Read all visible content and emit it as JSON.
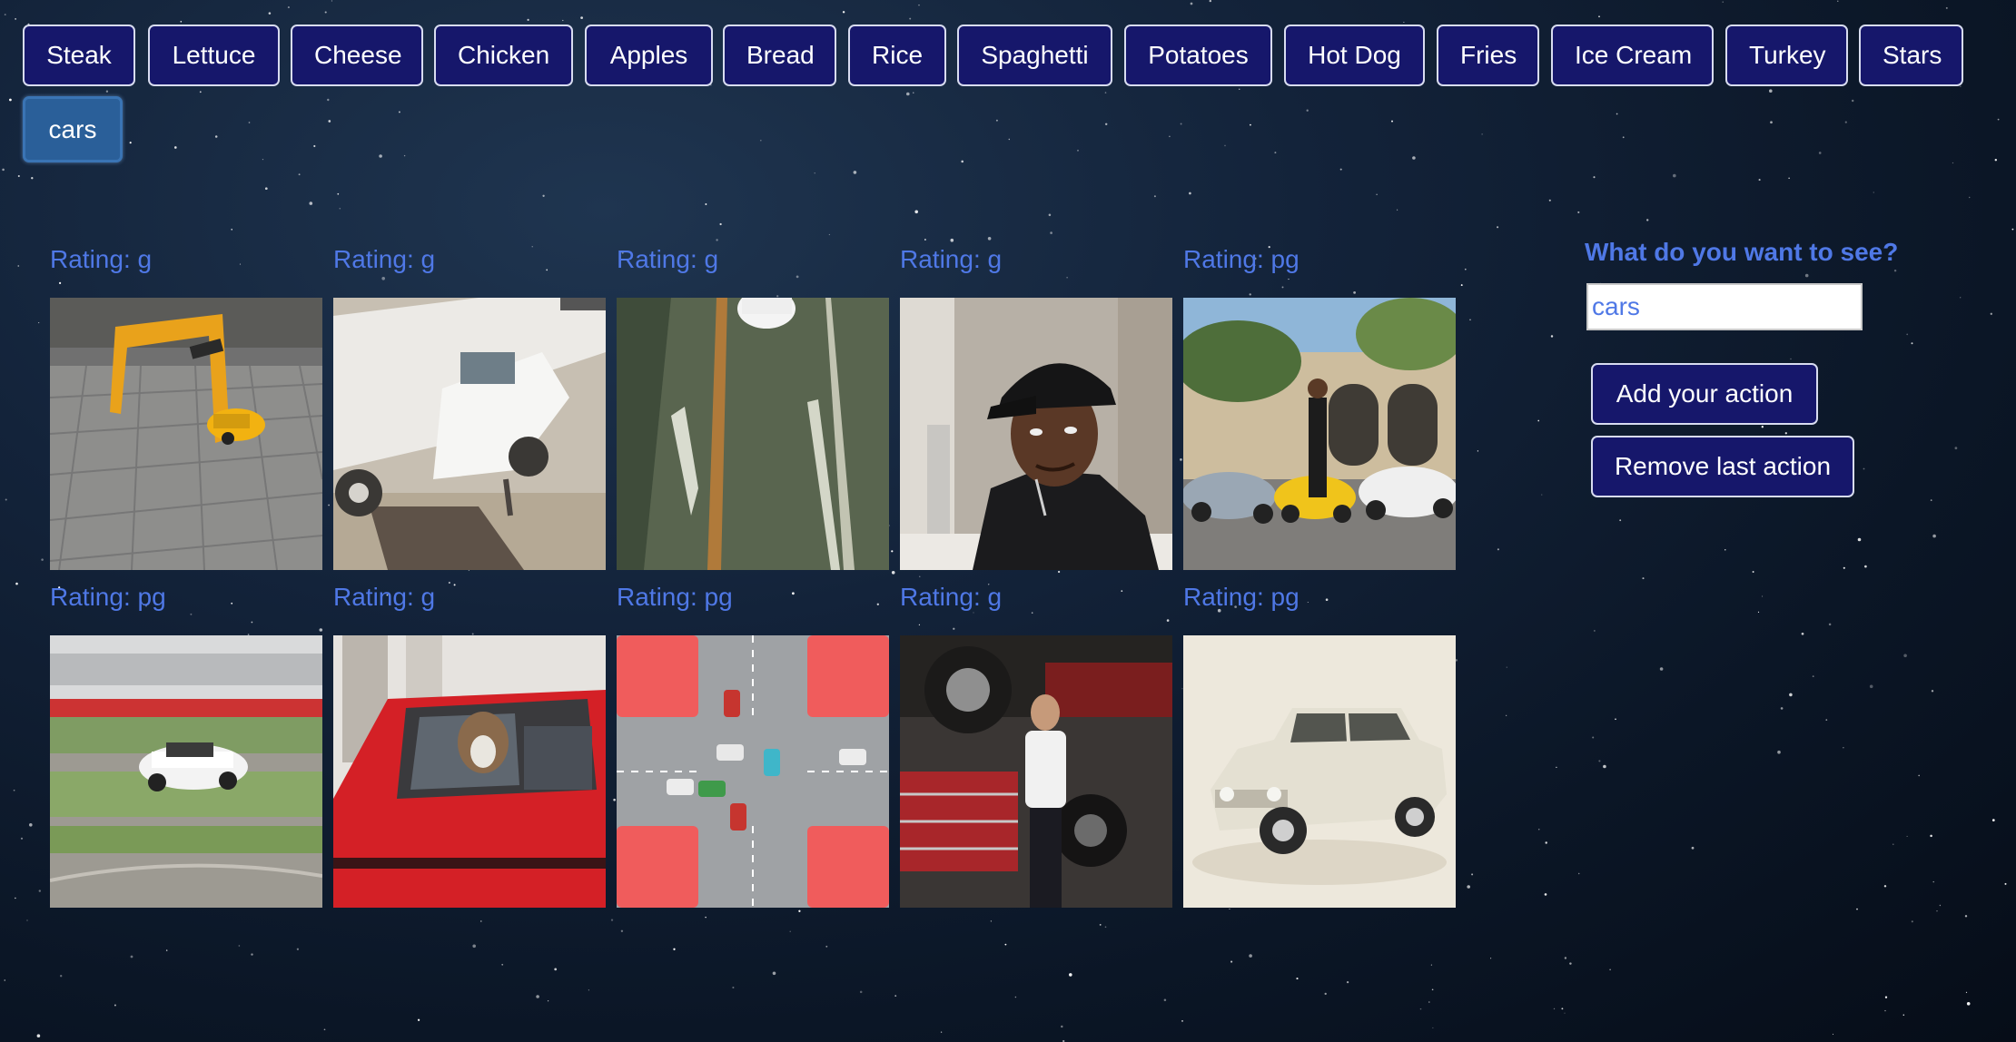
{
  "topics": [
    {
      "label": "Steak"
    },
    {
      "label": "Lettuce"
    },
    {
      "label": "Cheese"
    },
    {
      "label": "Chicken"
    },
    {
      "label": "Apples"
    },
    {
      "label": "Bread"
    },
    {
      "label": "Rice"
    },
    {
      "label": "Spaghetti"
    },
    {
      "label": "Potatoes"
    },
    {
      "label": "Hot Dog"
    },
    {
      "label": "Fries"
    },
    {
      "label": "Ice Cream"
    },
    {
      "label": "Turkey"
    },
    {
      "label": "Stars"
    },
    {
      "label": "cars",
      "active": true
    }
  ],
  "gifs": [
    {
      "rating": "Rating: g",
      "subject": "yellow-sports-car-gif"
    },
    {
      "rating": "Rating: g",
      "subject": "tow-truck-gif"
    },
    {
      "rating": "Rating: g",
      "subject": "highway-road-gif"
    },
    {
      "rating": "Rating: g",
      "subject": "man-in-cap-gif"
    },
    {
      "rating": "Rating: pg",
      "subject": "supercars-driveway-gif"
    },
    {
      "rating": "Rating: pg",
      "subject": "race-track-car-gif"
    },
    {
      "rating": "Rating: g",
      "subject": "dog-driving-red-car-gif"
    },
    {
      "rating": "Rating: pg",
      "subject": "intersection-traffic-gif"
    },
    {
      "rating": "Rating: g",
      "subject": "mechanic-garage-gif"
    },
    {
      "rating": "Rating: pg",
      "subject": "vintage-sedan-gif"
    }
  ],
  "sidebar": {
    "question": "What do you want to see?",
    "search_value": "cars",
    "add_label": "Add your action",
    "remove_label": "Remove last action"
  },
  "colors": {
    "button_bg": "#16176b",
    "active_button_bg": "#2a5f99",
    "accent_text": "#4f78e6"
  }
}
